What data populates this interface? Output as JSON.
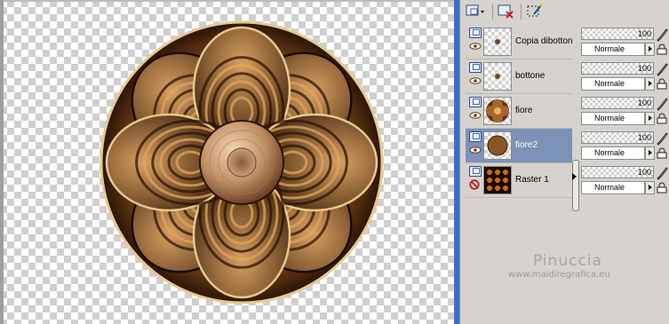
{
  "panel": {
    "toolbar": {
      "buttons": [
        {
          "icon": "new-layer-icon",
          "label": "new layer"
        },
        {
          "icon": "delete-layer-icon",
          "label": "delete layer"
        },
        {
          "icon": "mask-icon",
          "label": "mask"
        }
      ]
    },
    "layers": [
      {
        "name": "Copia dibottone",
        "opacity": "100",
        "blend": "Normale",
        "visible": true,
        "selected": false,
        "thumb": "button-small"
      },
      {
        "name": "bottone",
        "opacity": "100",
        "blend": "Normale",
        "visible": true,
        "selected": false,
        "thumb": "button-small"
      },
      {
        "name": "fiore",
        "opacity": "100",
        "blend": "Normale",
        "visible": true,
        "selected": false,
        "thumb": "flower"
      },
      {
        "name": "fiore2",
        "opacity": "100",
        "blend": "Normale",
        "visible": true,
        "selected": true,
        "thumb": "flower-solid"
      },
      {
        "name": "Raster 1",
        "opacity": "100",
        "blend": "Normale",
        "visible": false,
        "selected": false,
        "thumb": "raster"
      }
    ]
  },
  "watermark": {
    "name": "Pinuccia",
    "url": "www.maidiregrafica.eu"
  },
  "colors": {
    "selection": "#7b93b8",
    "panel_bg": "#d6d3ce",
    "accent_border": "#3b6fd0",
    "flower_dark": "#3a1f0a",
    "flower_mid": "#a8642a",
    "flower_light": "#e6b26a"
  }
}
